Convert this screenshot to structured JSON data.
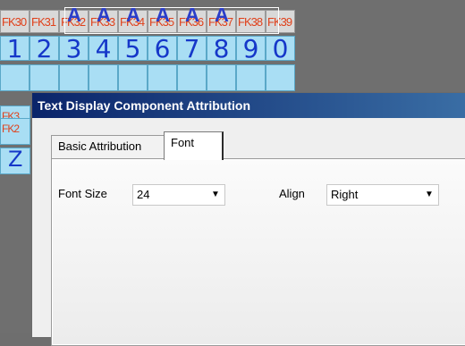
{
  "canvas": {
    "fk_labels": [
      "FK30",
      "FK31",
      "FK32",
      "FK33",
      "FK34",
      "FK35",
      "FK36",
      "FK37",
      "FK38",
      "FK39"
    ],
    "arrow_glyph": "A",
    "number_keys": [
      "1",
      "2",
      "3",
      "4",
      "5",
      "6",
      "7",
      "8",
      "9",
      "0"
    ],
    "left_labels": [
      "FK3",
      "FK2"
    ],
    "left_key": "Z"
  },
  "dialog": {
    "title": "Text Display Component Attribution",
    "tabs": [
      {
        "label": "Basic Attribution"
      },
      {
        "label": "Font"
      }
    ],
    "font_size": {
      "label": "Font Size",
      "value": "24"
    },
    "align": {
      "label": "Align",
      "value": "Right"
    },
    "dropdown_glyph": "▼"
  }
}
